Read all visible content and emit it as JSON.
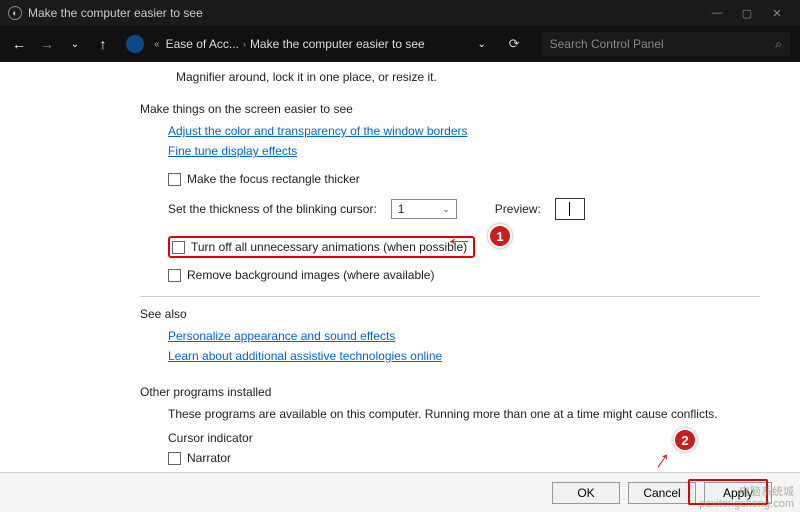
{
  "titlebar": {
    "title": "Make the computer easier to see"
  },
  "nav": {
    "crumb1": "Ease of Acc...",
    "crumb2": "Make the computer easier to see",
    "search_placeholder": "Search Control Panel"
  },
  "content": {
    "magnifier_line": "Magnifier around, lock it in one place, or resize it.",
    "section1_title": "Make things on the screen easier to see",
    "link_color": "Adjust the color and transparency of the window borders",
    "link_finetune": "Fine tune display effects",
    "cb_focus": "Make the focus rectangle thicker",
    "thickness_label": "Set the thickness of the blinking cursor:",
    "thickness_value": "1",
    "preview_label": "Preview:",
    "cb_animations": "Turn off all unnecessary animations (when possible)",
    "cb_background": "Remove background images (where available)",
    "seealso_title": "See also",
    "link_personalize": "Personalize appearance and sound effects",
    "link_assistive": "Learn about additional assistive technologies online",
    "other_title": "Other programs installed",
    "other_desc": "These programs are available on this computer. Running more than one at a time might cause conflicts.",
    "cursor_indicator": "Cursor indicator",
    "cb_narrator": "Narrator"
  },
  "footer": {
    "ok": "OK",
    "cancel": "Cancel",
    "apply": "Apply"
  },
  "callouts": {
    "one": "1",
    "two": "2"
  },
  "watermark": {
    "line1": "电脑系统城",
    "line2": "pcxitongcheng.com"
  }
}
